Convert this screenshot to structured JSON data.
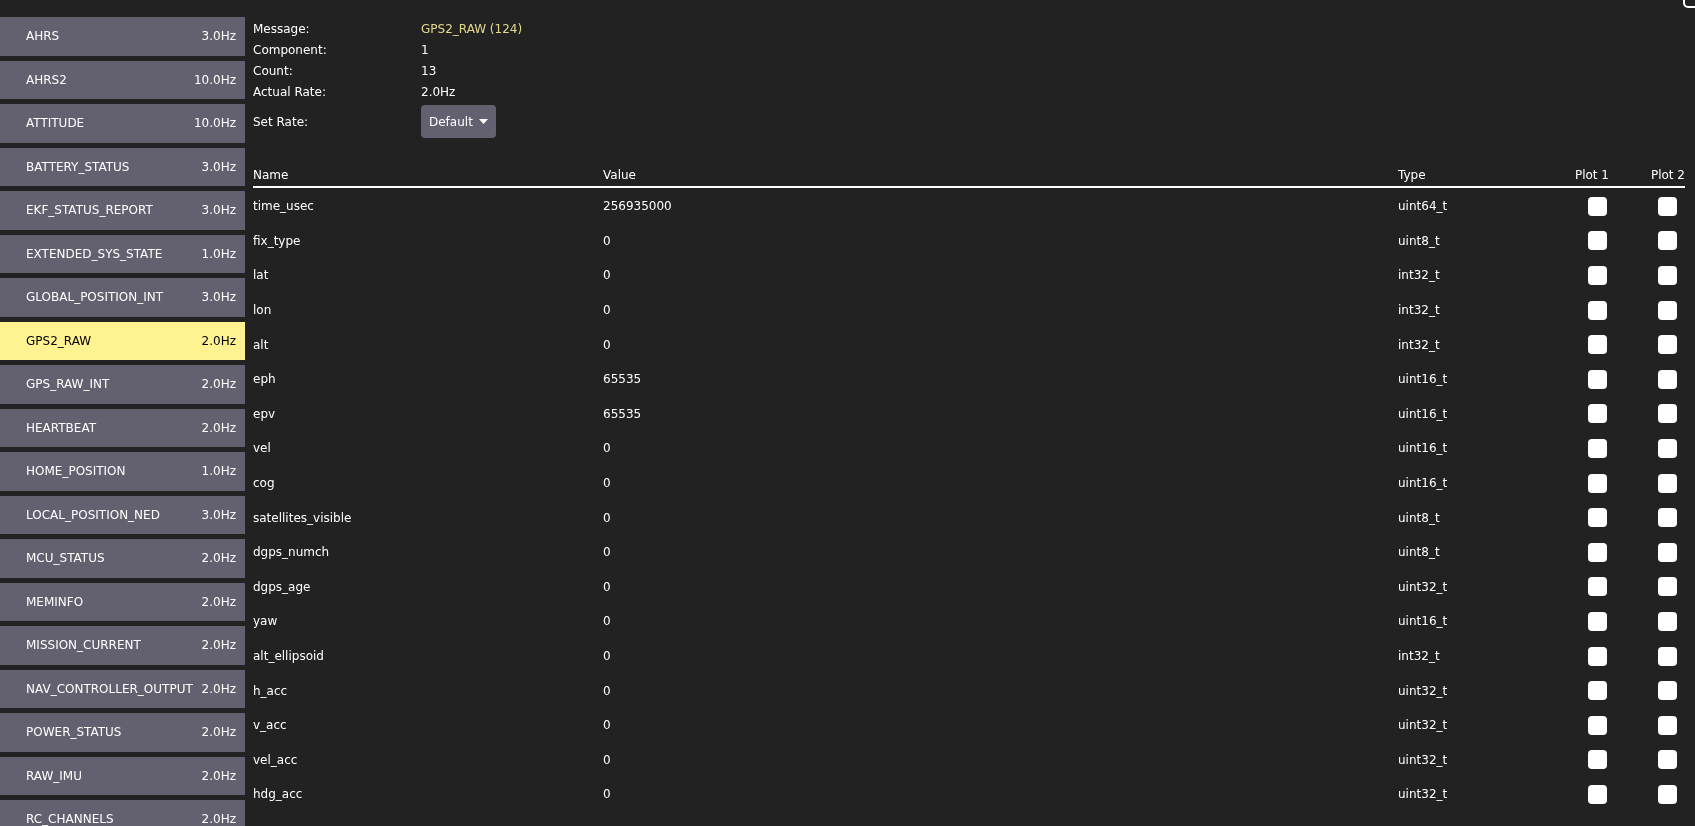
{
  "messages": [
    {
      "name": "AHRS",
      "rate": "3.0Hz",
      "selected": false
    },
    {
      "name": "AHRS2",
      "rate": "10.0Hz",
      "selected": false
    },
    {
      "name": "ATTITUDE",
      "rate": "10.0Hz",
      "selected": false
    },
    {
      "name": "BATTERY_STATUS",
      "rate": "3.0Hz",
      "selected": false
    },
    {
      "name": "EKF_STATUS_REPORT",
      "rate": "3.0Hz",
      "selected": false
    },
    {
      "name": "EXTENDED_SYS_STATE",
      "rate": "1.0Hz",
      "selected": false
    },
    {
      "name": "GLOBAL_POSITION_INT",
      "rate": "3.0Hz",
      "selected": false
    },
    {
      "name": "GPS2_RAW",
      "rate": "2.0Hz",
      "selected": true
    },
    {
      "name": "GPS_RAW_INT",
      "rate": "2.0Hz",
      "selected": false
    },
    {
      "name": "HEARTBEAT",
      "rate": "2.0Hz",
      "selected": false
    },
    {
      "name": "HOME_POSITION",
      "rate": "1.0Hz",
      "selected": false
    },
    {
      "name": "LOCAL_POSITION_NED",
      "rate": "3.0Hz",
      "selected": false
    },
    {
      "name": "MCU_STATUS",
      "rate": "2.0Hz",
      "selected": false
    },
    {
      "name": "MEMINFO",
      "rate": "2.0Hz",
      "selected": false
    },
    {
      "name": "MISSION_CURRENT",
      "rate": "2.0Hz",
      "selected": false
    },
    {
      "name": "NAV_CONTROLLER_OUTPUT",
      "rate": "2.0Hz",
      "selected": false
    },
    {
      "name": "POWER_STATUS",
      "rate": "2.0Hz",
      "selected": false
    },
    {
      "name": "RAW_IMU",
      "rate": "2.0Hz",
      "selected": false
    },
    {
      "name": "RC_CHANNELS",
      "rate": "2.0Hz",
      "selected": false
    }
  ],
  "info": [
    {
      "label": "Message:",
      "value": "GPS2_RAW (124)",
      "kind": "highlight"
    },
    {
      "label": "Component:",
      "value": "1",
      "kind": "plain"
    },
    {
      "label": "Count:",
      "value": "13",
      "kind": "plain"
    },
    {
      "label": "Actual Rate:",
      "value": "2.0Hz",
      "kind": "plain"
    }
  ],
  "set_rate": {
    "label": "Set Rate:",
    "value": "Default"
  },
  "table": {
    "columns": [
      "Name",
      "Value",
      "Type",
      "Plot 1",
      "Plot 2"
    ],
    "rows": [
      {
        "name": "time_usec",
        "value": "256935000",
        "type": "uint64_t",
        "plot1": false,
        "plot2": false
      },
      {
        "name": "fix_type",
        "value": "0",
        "type": "uint8_t",
        "plot1": false,
        "plot2": false
      },
      {
        "name": "lat",
        "value": "0",
        "type": "int32_t",
        "plot1": false,
        "plot2": false
      },
      {
        "name": "lon",
        "value": "0",
        "type": "int32_t",
        "plot1": false,
        "plot2": false
      },
      {
        "name": "alt",
        "value": "0",
        "type": "int32_t",
        "plot1": false,
        "plot2": false
      },
      {
        "name": "eph",
        "value": "65535",
        "type": "uint16_t",
        "plot1": false,
        "plot2": false
      },
      {
        "name": "epv",
        "value": "65535",
        "type": "uint16_t",
        "plot1": false,
        "plot2": false
      },
      {
        "name": "vel",
        "value": "0",
        "type": "uint16_t",
        "plot1": false,
        "plot2": false
      },
      {
        "name": "cog",
        "value": "0",
        "type": "uint16_t",
        "plot1": false,
        "plot2": false
      },
      {
        "name": "satellites_visible",
        "value": "0",
        "type": "uint8_t",
        "plot1": false,
        "plot2": false
      },
      {
        "name": "dgps_numch",
        "value": "0",
        "type": "uint8_t",
        "plot1": false,
        "plot2": false
      },
      {
        "name": "dgps_age",
        "value": "0",
        "type": "uint32_t",
        "plot1": false,
        "plot2": false
      },
      {
        "name": "yaw",
        "value": "0",
        "type": "uint16_t",
        "plot1": false,
        "plot2": false
      },
      {
        "name": "alt_ellipsoid",
        "value": "0",
        "type": "int32_t",
        "plot1": false,
        "plot2": false
      },
      {
        "name": "h_acc",
        "value": "0",
        "type": "uint32_t",
        "plot1": false,
        "plot2": false
      },
      {
        "name": "v_acc",
        "value": "0",
        "type": "uint32_t",
        "plot1": false,
        "plot2": false
      },
      {
        "name": "vel_acc",
        "value": "0",
        "type": "uint32_t",
        "plot1": false,
        "plot2": false
      },
      {
        "name": "hdg_acc",
        "value": "0",
        "type": "uint32_t",
        "plot1": false,
        "plot2": false
      }
    ]
  }
}
